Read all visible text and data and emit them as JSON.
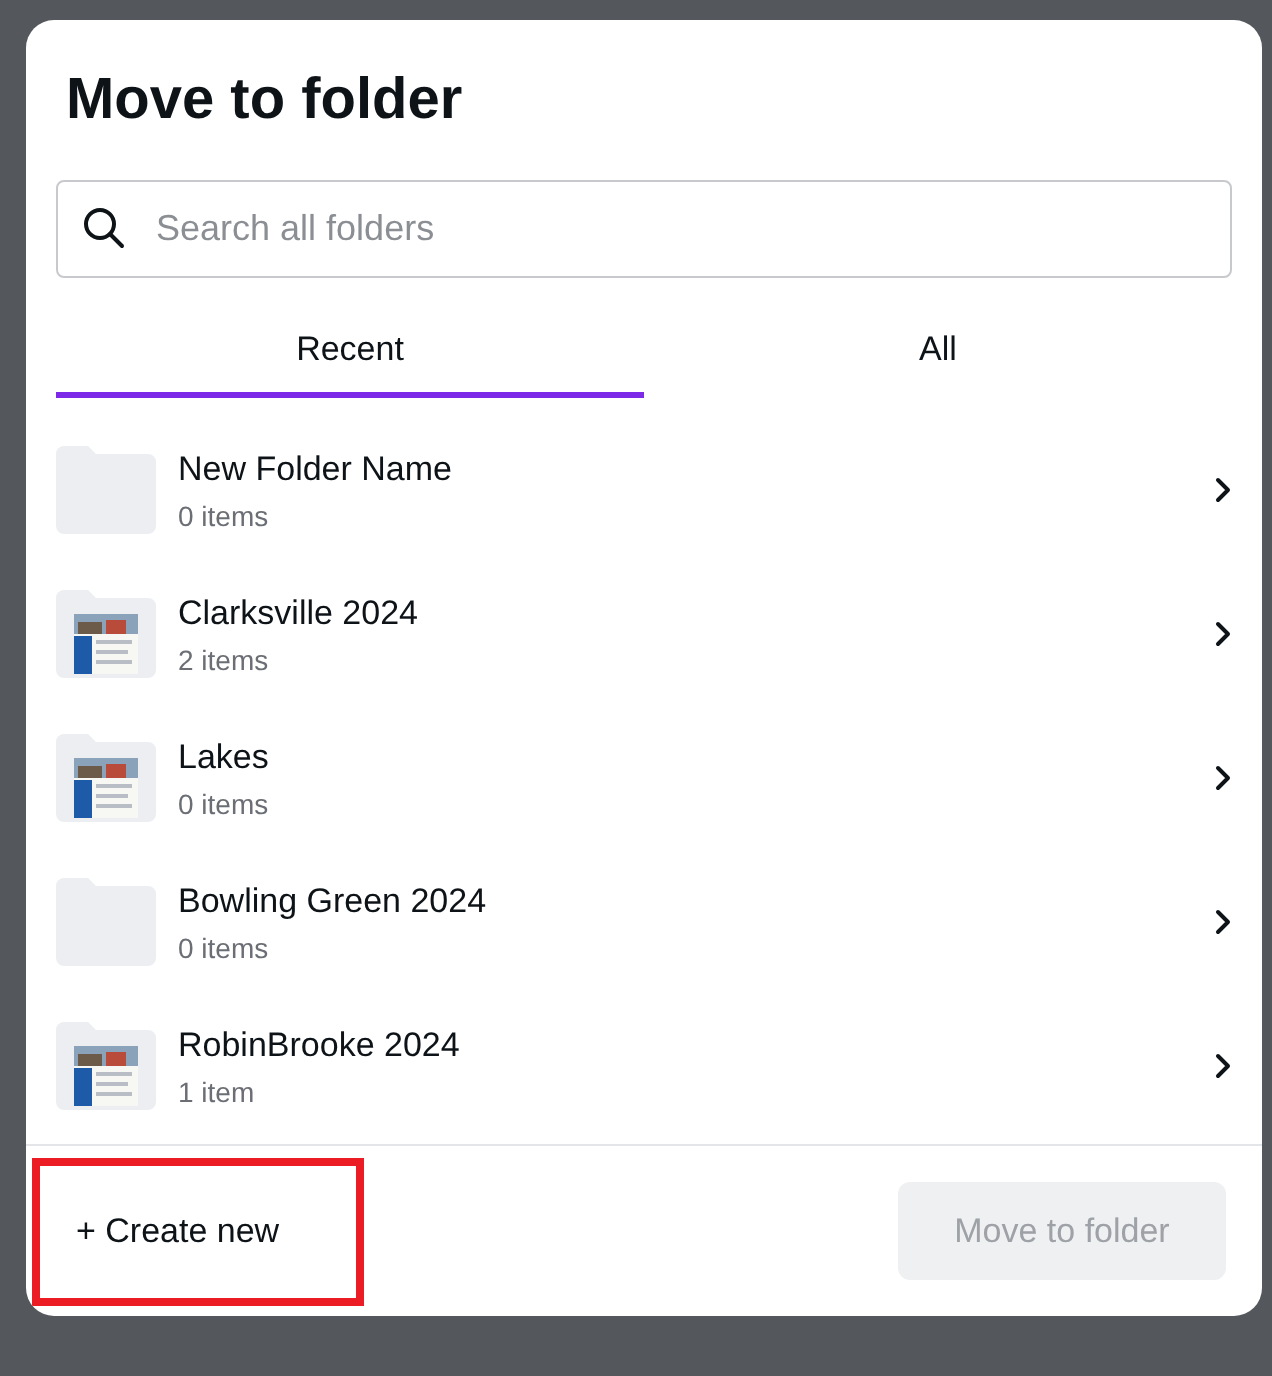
{
  "dialog": {
    "title": "Move to folder"
  },
  "search": {
    "placeholder": "Search all folders"
  },
  "tabs": [
    {
      "label": "Recent",
      "selected": true
    },
    {
      "label": "All",
      "selected": false
    }
  ],
  "folders": [
    {
      "name": "New Folder Name",
      "count": "0 items",
      "kind": "empty"
    },
    {
      "name": "Clarksville 2024",
      "count": "2 items",
      "kind": "preview"
    },
    {
      "name": "Lakes",
      "count": "0 items",
      "kind": "preview"
    },
    {
      "name": "Bowling Green 2024",
      "count": "0 items",
      "kind": "empty"
    },
    {
      "name": "RobinBrooke 2024",
      "count": "1 item",
      "kind": "preview"
    }
  ],
  "footer": {
    "create": {
      "label": "+ Create new",
      "highlighted": true
    },
    "move": {
      "label": "Move to folder",
      "disabled": true
    }
  }
}
